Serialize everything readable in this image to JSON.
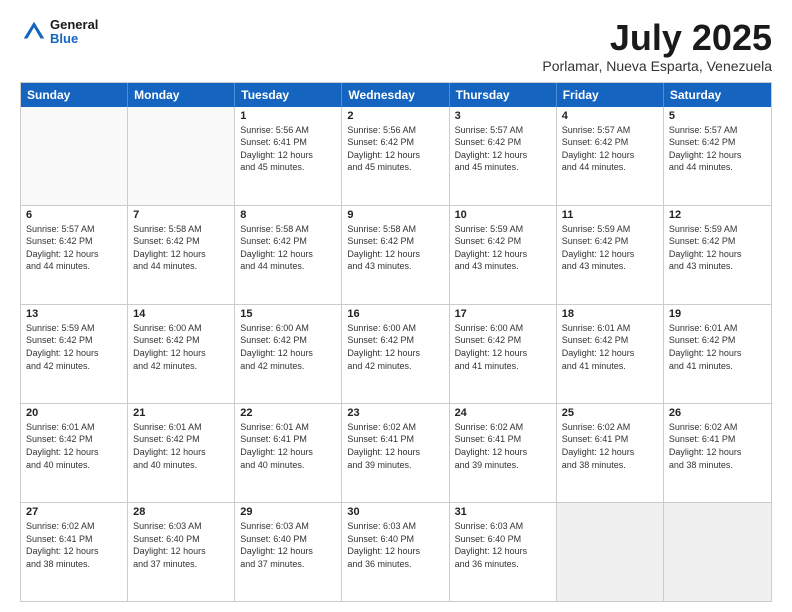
{
  "header": {
    "logo_general": "General",
    "logo_blue": "Blue",
    "month_title": "July 2025",
    "location": "Porlamar, Nueva Esparta, Venezuela"
  },
  "days_of_week": [
    "Sunday",
    "Monday",
    "Tuesday",
    "Wednesday",
    "Thursday",
    "Friday",
    "Saturday"
  ],
  "weeks": [
    [
      {
        "day": "",
        "lines": [],
        "empty": true
      },
      {
        "day": "",
        "lines": [],
        "empty": true
      },
      {
        "day": "1",
        "lines": [
          "Sunrise: 5:56 AM",
          "Sunset: 6:41 PM",
          "Daylight: 12 hours",
          "and 45 minutes."
        ]
      },
      {
        "day": "2",
        "lines": [
          "Sunrise: 5:56 AM",
          "Sunset: 6:42 PM",
          "Daylight: 12 hours",
          "and 45 minutes."
        ]
      },
      {
        "day": "3",
        "lines": [
          "Sunrise: 5:57 AM",
          "Sunset: 6:42 PM",
          "Daylight: 12 hours",
          "and 45 minutes."
        ]
      },
      {
        "day": "4",
        "lines": [
          "Sunrise: 5:57 AM",
          "Sunset: 6:42 PM",
          "Daylight: 12 hours",
          "and 44 minutes."
        ]
      },
      {
        "day": "5",
        "lines": [
          "Sunrise: 5:57 AM",
          "Sunset: 6:42 PM",
          "Daylight: 12 hours",
          "and 44 minutes."
        ]
      }
    ],
    [
      {
        "day": "6",
        "lines": [
          "Sunrise: 5:57 AM",
          "Sunset: 6:42 PM",
          "Daylight: 12 hours",
          "and 44 minutes."
        ]
      },
      {
        "day": "7",
        "lines": [
          "Sunrise: 5:58 AM",
          "Sunset: 6:42 PM",
          "Daylight: 12 hours",
          "and 44 minutes."
        ]
      },
      {
        "day": "8",
        "lines": [
          "Sunrise: 5:58 AM",
          "Sunset: 6:42 PM",
          "Daylight: 12 hours",
          "and 44 minutes."
        ]
      },
      {
        "day": "9",
        "lines": [
          "Sunrise: 5:58 AM",
          "Sunset: 6:42 PM",
          "Daylight: 12 hours",
          "and 43 minutes."
        ]
      },
      {
        "day": "10",
        "lines": [
          "Sunrise: 5:59 AM",
          "Sunset: 6:42 PM",
          "Daylight: 12 hours",
          "and 43 minutes."
        ]
      },
      {
        "day": "11",
        "lines": [
          "Sunrise: 5:59 AM",
          "Sunset: 6:42 PM",
          "Daylight: 12 hours",
          "and 43 minutes."
        ]
      },
      {
        "day": "12",
        "lines": [
          "Sunrise: 5:59 AM",
          "Sunset: 6:42 PM",
          "Daylight: 12 hours",
          "and 43 minutes."
        ]
      }
    ],
    [
      {
        "day": "13",
        "lines": [
          "Sunrise: 5:59 AM",
          "Sunset: 6:42 PM",
          "Daylight: 12 hours",
          "and 42 minutes."
        ]
      },
      {
        "day": "14",
        "lines": [
          "Sunrise: 6:00 AM",
          "Sunset: 6:42 PM",
          "Daylight: 12 hours",
          "and 42 minutes."
        ]
      },
      {
        "day": "15",
        "lines": [
          "Sunrise: 6:00 AM",
          "Sunset: 6:42 PM",
          "Daylight: 12 hours",
          "and 42 minutes."
        ]
      },
      {
        "day": "16",
        "lines": [
          "Sunrise: 6:00 AM",
          "Sunset: 6:42 PM",
          "Daylight: 12 hours",
          "and 42 minutes."
        ]
      },
      {
        "day": "17",
        "lines": [
          "Sunrise: 6:00 AM",
          "Sunset: 6:42 PM",
          "Daylight: 12 hours",
          "and 41 minutes."
        ]
      },
      {
        "day": "18",
        "lines": [
          "Sunrise: 6:01 AM",
          "Sunset: 6:42 PM",
          "Daylight: 12 hours",
          "and 41 minutes."
        ]
      },
      {
        "day": "19",
        "lines": [
          "Sunrise: 6:01 AM",
          "Sunset: 6:42 PM",
          "Daylight: 12 hours",
          "and 41 minutes."
        ]
      }
    ],
    [
      {
        "day": "20",
        "lines": [
          "Sunrise: 6:01 AM",
          "Sunset: 6:42 PM",
          "Daylight: 12 hours",
          "and 40 minutes."
        ]
      },
      {
        "day": "21",
        "lines": [
          "Sunrise: 6:01 AM",
          "Sunset: 6:42 PM",
          "Daylight: 12 hours",
          "and 40 minutes."
        ]
      },
      {
        "day": "22",
        "lines": [
          "Sunrise: 6:01 AM",
          "Sunset: 6:41 PM",
          "Daylight: 12 hours",
          "and 40 minutes."
        ]
      },
      {
        "day": "23",
        "lines": [
          "Sunrise: 6:02 AM",
          "Sunset: 6:41 PM",
          "Daylight: 12 hours",
          "and 39 minutes."
        ]
      },
      {
        "day": "24",
        "lines": [
          "Sunrise: 6:02 AM",
          "Sunset: 6:41 PM",
          "Daylight: 12 hours",
          "and 39 minutes."
        ]
      },
      {
        "day": "25",
        "lines": [
          "Sunrise: 6:02 AM",
          "Sunset: 6:41 PM",
          "Daylight: 12 hours",
          "and 38 minutes."
        ]
      },
      {
        "day": "26",
        "lines": [
          "Sunrise: 6:02 AM",
          "Sunset: 6:41 PM",
          "Daylight: 12 hours",
          "and 38 minutes."
        ]
      }
    ],
    [
      {
        "day": "27",
        "lines": [
          "Sunrise: 6:02 AM",
          "Sunset: 6:41 PM",
          "Daylight: 12 hours",
          "and 38 minutes."
        ]
      },
      {
        "day": "28",
        "lines": [
          "Sunrise: 6:03 AM",
          "Sunset: 6:40 PM",
          "Daylight: 12 hours",
          "and 37 minutes."
        ]
      },
      {
        "day": "29",
        "lines": [
          "Sunrise: 6:03 AM",
          "Sunset: 6:40 PM",
          "Daylight: 12 hours",
          "and 37 minutes."
        ]
      },
      {
        "day": "30",
        "lines": [
          "Sunrise: 6:03 AM",
          "Sunset: 6:40 PM",
          "Daylight: 12 hours",
          "and 36 minutes."
        ]
      },
      {
        "day": "31",
        "lines": [
          "Sunrise: 6:03 AM",
          "Sunset: 6:40 PM",
          "Daylight: 12 hours",
          "and 36 minutes."
        ]
      },
      {
        "day": "",
        "lines": [],
        "empty": true,
        "shaded": true
      },
      {
        "day": "",
        "lines": [],
        "empty": true,
        "shaded": true
      }
    ]
  ]
}
